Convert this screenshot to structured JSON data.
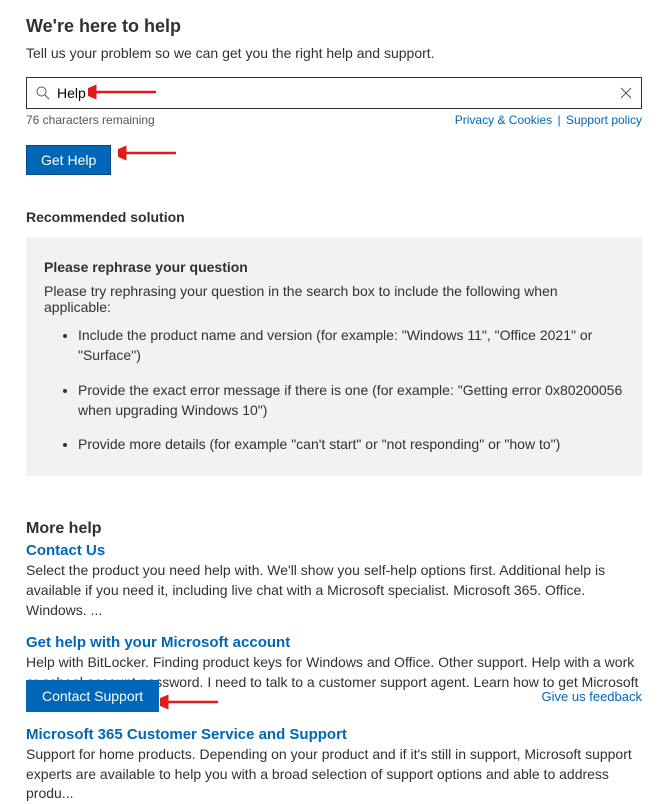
{
  "header": {
    "title": "We're here to help",
    "subtitle": "Tell us your problem so we can get you the right help and support."
  },
  "search": {
    "value": "Help",
    "placeholder": "",
    "chars_remaining": "76 characters remaining",
    "privacy_label": "Privacy & Cookies",
    "support_policy_label": "Support policy"
  },
  "buttons": {
    "get_help": "Get Help",
    "contact_support": "Contact Support"
  },
  "recommended": {
    "heading": "Recommended solution",
    "title": "Please rephrase your question",
    "instruction": "Please try rephrasing your question in the search box to include the following when applicable:",
    "bullets": [
      "Include the product name and version (for example: \"Windows 11\", \"Office 2021\" or \"Surface\")",
      "Provide the exact error message if there is one (for example: \"Getting error 0x80200056 when upgrading Windows 10\")",
      "Provide more details (for example \"can't start\" or \"not responding\" or \"how to\")"
    ]
  },
  "more_help": {
    "heading": "More help",
    "items": [
      {
        "title": "Contact Us",
        "desc": "Select the product you need help with. We'll show you self-help options first. Additional help is available if you need it, including live chat with a Microsoft specialist. Microsoft 365. Office. Windows. ..."
      },
      {
        "title": "Get help with your Microsoft account",
        "desc": "Help with BitLocker. Finding product keys for Windows and Office. Other support. Help with a work or school account password. I need to talk to a customer support agent. Learn how to get Microsoft ..."
      },
      {
        "title": "Microsoft 365 Customer Service and Support",
        "desc": "Support for home products. Depending on your product and if it's still in support, Microsoft support experts are available to help you with a broad selection of support options and able to address produ..."
      }
    ]
  },
  "footer": {
    "feedback": "Give us feedback"
  }
}
